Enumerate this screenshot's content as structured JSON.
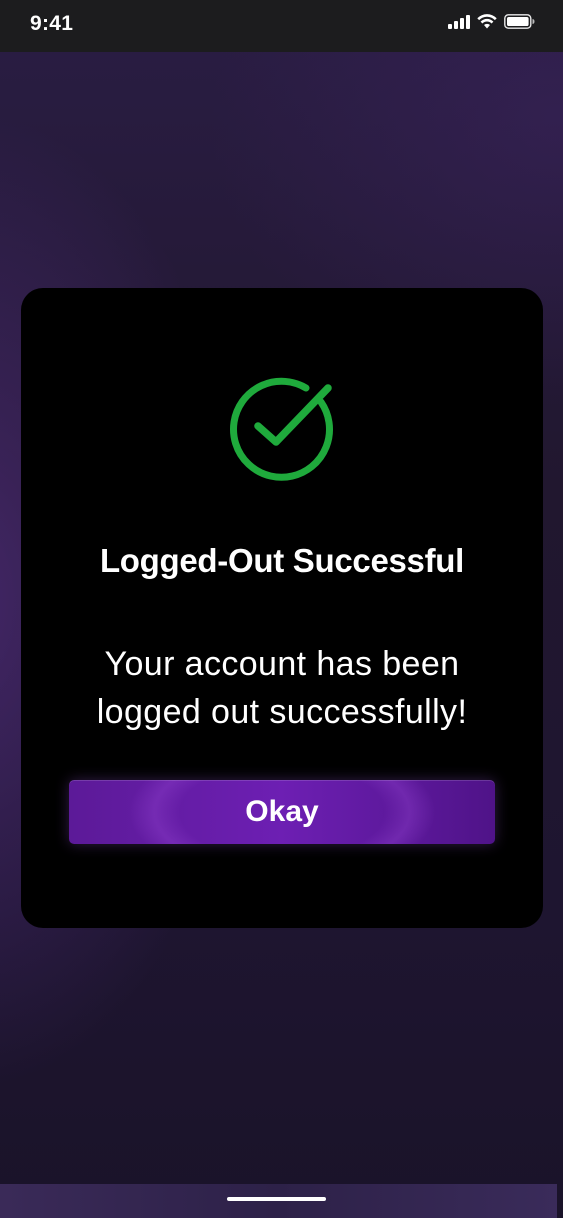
{
  "status_bar": {
    "time": "9:41",
    "icons": [
      "cellular-signal-icon",
      "wifi-icon",
      "battery-icon"
    ]
  },
  "modal": {
    "icon": "check-circle-icon",
    "icon_color": "#1faa3c",
    "title": "Logged-Out Successful",
    "message": "Your account has been logged out successfully!",
    "button_label": "Okay",
    "button_color": "#6a1fae"
  }
}
